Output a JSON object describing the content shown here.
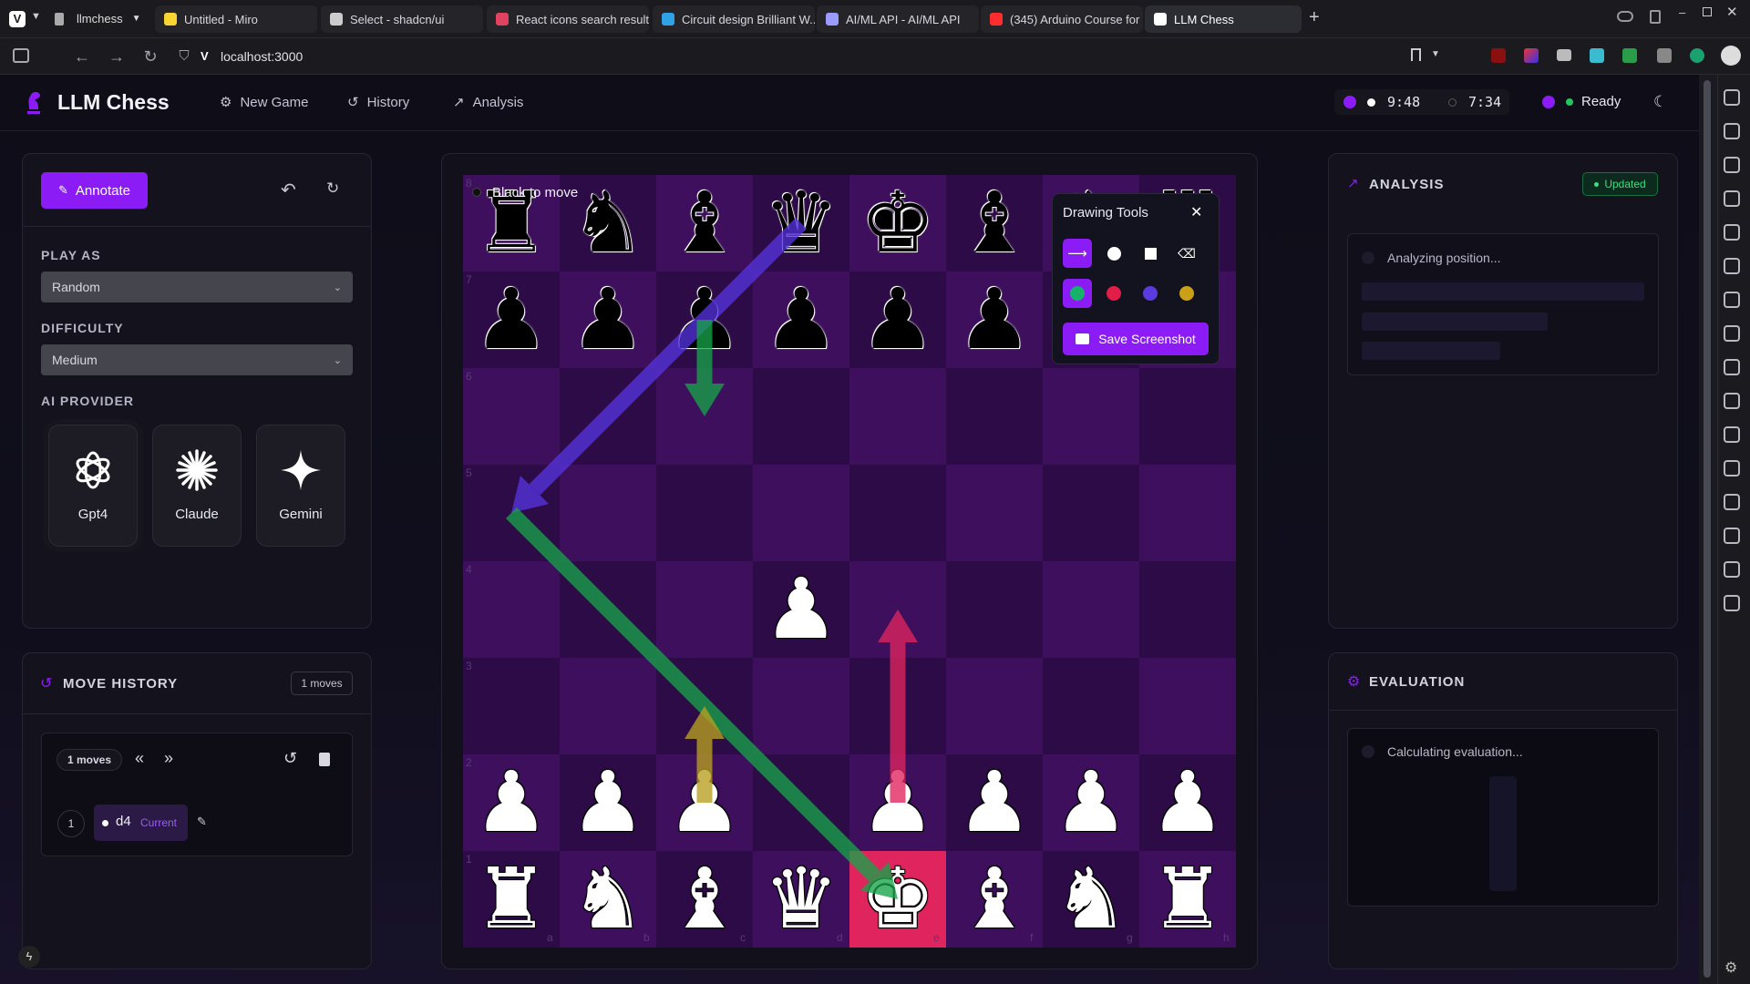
{
  "browser": {
    "profile": "llmchess",
    "tabs": [
      {
        "label": "Untitled - Miro",
        "icon": "miro-icon",
        "color": "#f7d634"
      },
      {
        "label": "Select - shadcn/ui",
        "icon": "shadcn-icon",
        "color": "#cccccc"
      },
      {
        "label": "React icons search results",
        "icon": "react-icons-icon",
        "color": "#e0435f"
      },
      {
        "label": "Circuit design Brilliant W...",
        "icon": "tinkercad-icon",
        "color": "#2fa3e6"
      },
      {
        "label": "AI/ML API - AI/ML API",
        "icon": "aiml-icon",
        "color": "#9a9aff"
      },
      {
        "label": "(345) Arduino Course for ...",
        "icon": "youtube-icon",
        "color": "#ff2d2d"
      },
      {
        "label": "LLM Chess",
        "icon": "app-icon",
        "color": "#ffffff"
      }
    ],
    "url": "localhost:3000"
  },
  "header": {
    "app_title": "LLM Chess",
    "nav": [
      {
        "label": "New Game",
        "icon": "new-game-icon"
      },
      {
        "label": "History",
        "icon": "history-icon"
      },
      {
        "label": "Analysis",
        "icon": "analysis-icon"
      }
    ],
    "white_clock": "9:48",
    "black_clock": "7:34",
    "status": "Ready"
  },
  "settings": {
    "annotate_label": "Annotate",
    "play_as_label": "PLAY AS",
    "play_as_value": "Random",
    "difficulty_label": "DIFFICULTY",
    "difficulty_value": "Medium",
    "provider_label": "AI PROVIDER",
    "providers": [
      {
        "name": "Gpt4",
        "icon": "openai-icon",
        "selected": true
      },
      {
        "name": "Claude",
        "icon": "claude-icon",
        "selected": false
      },
      {
        "name": "Gemini",
        "icon": "gemini-icon",
        "selected": false
      }
    ]
  },
  "move_history": {
    "title": "MOVE HISTORY",
    "count_badge": "1 moves",
    "inner_badge": "1 moves",
    "moves": [
      {
        "number": "1",
        "san": "d4",
        "tag": "Current"
      }
    ]
  },
  "board": {
    "turn_text": "Black to move",
    "ranks": [
      "8",
      "7",
      "6",
      "5",
      "4",
      "3",
      "2",
      "1"
    ],
    "files": [
      "a",
      "b",
      "c",
      "d",
      "e",
      "f",
      "g",
      "h"
    ],
    "highlight_square": "e1",
    "pieces": {
      "8": [
        "br",
        "bn",
        "bb",
        "bq",
        "bk",
        "bb",
        "bn",
        "br"
      ],
      "7": [
        "bp",
        "bp",
        "bp",
        "bp",
        "bp",
        "bp",
        "bp",
        "bp"
      ],
      "6": [
        "",
        "",
        "",
        "",
        "",
        "",
        "",
        ""
      ],
      "5": [
        "",
        "",
        "",
        "",
        "",
        "",
        "",
        ""
      ],
      "4": [
        "",
        "",
        "",
        "wp",
        "",
        "",
        "",
        ""
      ],
      "3": [
        "",
        "",
        "",
        "",
        "",
        "",
        "",
        ""
      ],
      "2": [
        "wp",
        "wp",
        "wp",
        "",
        "wp",
        "wp",
        "wp",
        "wp"
      ],
      "1": [
        "wr",
        "wn",
        "wb",
        "wq",
        "wk",
        "wb",
        "wn",
        "wr"
      ]
    },
    "arrows": [
      {
        "from": "d8",
        "to": "a5",
        "color": "#5533dd"
      },
      {
        "from": "a5",
        "to": "e1",
        "color": "#17a349"
      },
      {
        "from": "c7",
        "to": "c6",
        "color": "#17a349"
      },
      {
        "from": "c2",
        "to": "c3",
        "color": "#b8a020"
      },
      {
        "from": "e2",
        "to": "e4",
        "color": "#e0245e"
      }
    ]
  },
  "drawing_tools": {
    "title": "Drawing Tools",
    "tools": [
      "arrow-icon",
      "circle-icon",
      "square-icon",
      "eraser-icon"
    ],
    "colors": [
      "#17b26a",
      "#e11d48",
      "#5b3bdc",
      "#cca016"
    ],
    "save_label": "Save Screenshot"
  },
  "analysis": {
    "title": "ANALYSIS",
    "badge": "Updated",
    "loading_text": "Analyzing position..."
  },
  "evaluation": {
    "title": "EVALUATION",
    "loading_text": "Calculating evaluation..."
  },
  "colors": {
    "accent": "#8b1cf6",
    "board_light": "#3d0f5c",
    "board_dark": "#2d0b47",
    "highlight": "#e0245e"
  }
}
